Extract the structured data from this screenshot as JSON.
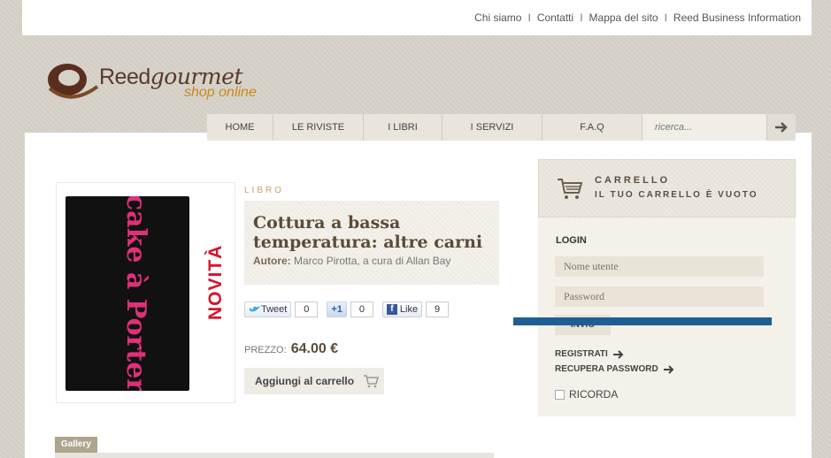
{
  "topbar": {
    "links": [
      "Chi siamo",
      "Contatti",
      "Mappa del sito",
      "Reed Business Information"
    ],
    "separator": "I"
  },
  "logo": {
    "brand_main": "Reed",
    "brand_script": "gourmet",
    "tagline": "shop online"
  },
  "nav": {
    "items": [
      "HOME",
      "LE RIVISTE",
      "I LIBRI",
      "I SERVIZI",
      "F.A.Q"
    ],
    "search_placeholder": "ricerca..."
  },
  "product": {
    "section": "LIBRO",
    "title": "Cottura a bassa temperatura: altre carni",
    "author_label": "Autore:",
    "author": "Marco Pirotta, a cura di Allan Bay",
    "badge": "NOVITÀ",
    "cover_text": "cake à Porter",
    "price_label": "PREZZO:",
    "price": "64.00 €",
    "add_to_cart": "Aggiungi al carrello"
  },
  "social": {
    "tweet_label": "Tweet",
    "tweet_count": "0",
    "plus_label": "+1",
    "plus_count": "0",
    "like_label": "Like",
    "like_count": "9"
  },
  "gallery": {
    "label": "Gallery"
  },
  "cart": {
    "title": "CARRELLO",
    "status": "IL TUO CARRELLO È VUOTO"
  },
  "login": {
    "title": "LOGIN",
    "username_placeholder": "Nome utente",
    "password_placeholder": "Password",
    "submit": "INVIO",
    "register": "REGISTRATI",
    "recover": "RECUPERA PASSWORD",
    "remember": "RICORDA"
  },
  "colors": {
    "accent": "#c88a1c",
    "badge": "#d7142d",
    "cover_pink": "#e0307a",
    "footer_blue": "#1d5f94"
  }
}
